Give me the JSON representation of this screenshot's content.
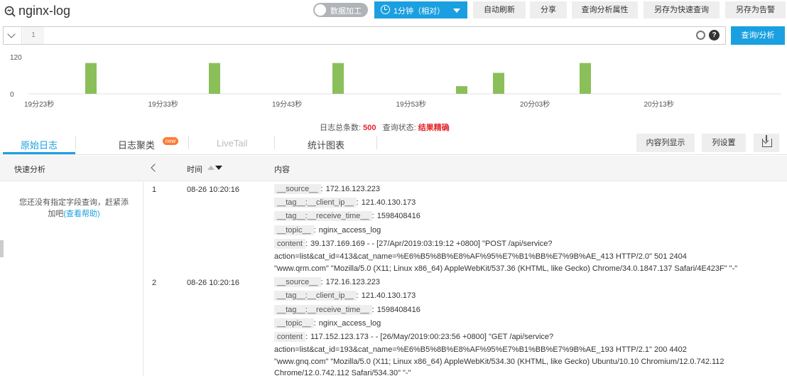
{
  "header": {
    "title": "nginx-log",
    "toggle_label": "数据加工",
    "time_range": "1分钟（相对）",
    "buttons": [
      "自动刷新",
      "分享",
      "查询分析属性",
      "另存为快速查询",
      "另存为告警"
    ]
  },
  "query": {
    "line_number": "1",
    "search_button": "查询/分析"
  },
  "histogram": {
    "type": "bar",
    "y_ticks": [
      "120",
      "0"
    ],
    "x_ticks": [
      "19分23秒",
      "19分33秒",
      "19分43秒",
      "19分53秒",
      "20分03秒",
      "20分13秒"
    ],
    "values": [
      100,
      100,
      100,
      25,
      68,
      100
    ],
    "ylim": [
      0,
      120
    ],
    "bar_color": "#8bbf5a"
  },
  "summary": {
    "total_label": "日志总条数:",
    "total_value": "500",
    "status_label": "查询状态:",
    "status_value": "结果精确"
  },
  "tabs": {
    "items": [
      "原始日志",
      "日志聚类",
      "LiveTail",
      "统计图表"
    ],
    "new_badge": "new",
    "right_buttons": [
      "内容列显示",
      "列设置"
    ]
  },
  "table": {
    "headers": {
      "quick": "快速分析",
      "time": "时间",
      "content": "内容"
    }
  },
  "left_panel": {
    "text": "您还没有指定字段查询，赶紧添加吧",
    "link": "(查看帮助)"
  },
  "logs": [
    {
      "num": "1",
      "time": "08-26 10:20:16",
      "fields": [
        {
          "key": "__source__",
          "value": "172.16.123.223"
        },
        {
          "key": "__tag__:__client_ip__",
          "value": "121.40.130.173"
        },
        {
          "key": "__tag__:__receive_time__",
          "value": "1598408416"
        },
        {
          "key": "__topic__",
          "value": "nginx_access_log"
        }
      ],
      "content_key": "content",
      "content_lines": [
        "39.137.169.169 - - [27/Apr/2019:03:19:12 +0800] \"POST /api/service?",
        "action=list&cat_id=413&cat_name=%E6%B5%8B%E8%AF%95%E7%B1%BB%E7%9B%AE_413 HTTP/2.0\" 501 2404",
        "\"www.qrm.com\" \"Mozilla/5.0 (X11; Linux x86_64) AppleWebKit/537.36 (KHTML, like Gecko) Chrome/34.0.1847.137 Safari/4E423F\" \"-\""
      ]
    },
    {
      "num": "2",
      "time": "08-26 10:20:16",
      "fields": [
        {
          "key": "__source__",
          "value": "172.16.123.223"
        },
        {
          "key": "__tag__:__client_ip__",
          "value": "121.40.130.173"
        },
        {
          "key": "__tag__:__receive_time__",
          "value": "1598408416"
        },
        {
          "key": "__topic__",
          "value": "nginx_access_log"
        }
      ],
      "content_key": "content",
      "content_lines": [
        "117.152.123.173 - - [26/May/2019:00:23:56 +0800] \"GET /api/service?",
        "action=list&cat_id=193&cat_name=%E6%B5%8B%E8%AF%95%E7%B1%BB%E7%9B%AE_193 HTTP/2.1\" 200 4402",
        "\"www.gnq.com\" \"Mozilla/5.0 (X11; Linux x86_64) AppleWebKit/534.30 (KHTML, like Gecko) Ubuntu/10.10 Chromium/12.0.742.112",
        "Chrome/12.0.742.112 Safari/534.30\" \"-\""
      ]
    }
  ]
}
